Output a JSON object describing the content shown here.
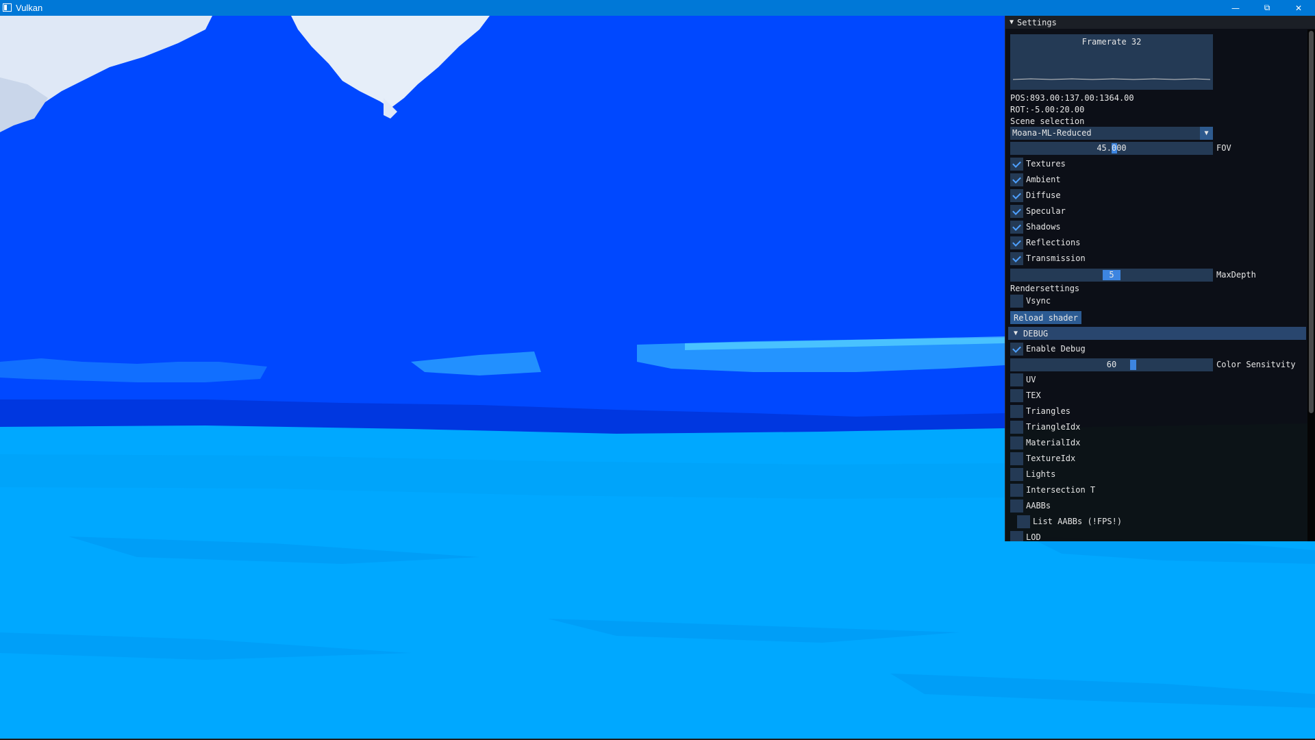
{
  "window": {
    "title": "Vulkan",
    "minimize_icon": "minimize-icon",
    "restore_icon": "restore-icon",
    "close_icon": "close-icon"
  },
  "settings": {
    "header": "Settings",
    "framerate_label": "Framerate 32",
    "framerate_value": 32,
    "pos": "POS:893.00:137.00:1364.00",
    "rot": "ROT:-5.00:20.00",
    "scene_selection_label": "Scene selection",
    "scene_selected": "Moana-ML-Reduced",
    "fov_value": "45.000",
    "fov_label": "FOV",
    "toggles": [
      {
        "label": "Textures",
        "checked": true
      },
      {
        "label": "Ambient",
        "checked": true
      },
      {
        "label": "Diffuse",
        "checked": true
      },
      {
        "label": "Specular",
        "checked": true
      },
      {
        "label": "Shadows",
        "checked": true
      },
      {
        "label": "Reflections",
        "checked": true
      },
      {
        "label": "Transmission",
        "checked": true
      }
    ],
    "maxdepth_value": "5",
    "maxdepth_label": "MaxDepth",
    "rendersettings_label": "Rendersettings",
    "vsync_label": "Vsync",
    "vsync_checked": false,
    "reload_shader_label": "Reload shader"
  },
  "debug": {
    "header": "DEBUG",
    "enable_debug_label": "Enable Debug",
    "enable_debug_checked": true,
    "color_sensitivity_value": "60",
    "color_sensitivity_label": "Color Sensitvity",
    "options": [
      {
        "label": "UV",
        "checked": false
      },
      {
        "label": "TEX",
        "checked": false
      },
      {
        "label": "Triangles",
        "checked": false
      },
      {
        "label": "TriangleIdx",
        "checked": false
      },
      {
        "label": "MaterialIdx",
        "checked": false
      },
      {
        "label": "TextureIdx",
        "checked": false
      },
      {
        "label": "Lights",
        "checked": false
      },
      {
        "label": "Intersection T",
        "checked": false
      },
      {
        "label": "AABBs",
        "checked": false
      }
    ],
    "list_aabbs_label": "List AABBs (!FPS!)",
    "list_aabbs_checked": false,
    "lod_label": "LOD"
  },
  "colors": {
    "sky_blue": "#0048ff",
    "water_blue": "#00a8ff",
    "panel_accent": "#3d85e0"
  }
}
